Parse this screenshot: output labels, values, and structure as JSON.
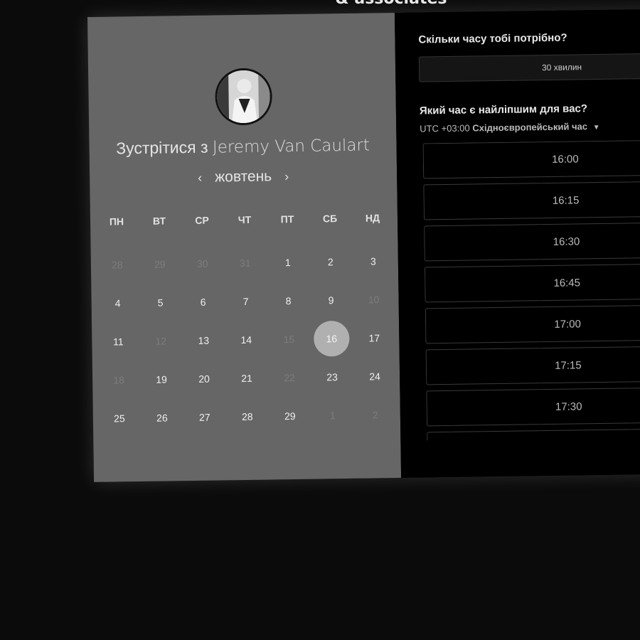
{
  "brand": "& associates",
  "host": {
    "title_prefix": "Зустрітися з",
    "name": "Jeremy Van Caulart"
  },
  "calendar": {
    "month": "жовтень",
    "prev_icon": "chevron-left-icon",
    "next_icon": "chevron-right-icon",
    "weekdays": [
      "ПН",
      "ВТ",
      "СР",
      "ЧТ",
      "ПТ",
      "СБ",
      "НД"
    ],
    "weeks": [
      [
        {
          "d": "28",
          "muted": true
        },
        {
          "d": "29",
          "muted": true
        },
        {
          "d": "30",
          "muted": true
        },
        {
          "d": "31",
          "muted": true
        },
        {
          "d": "1"
        },
        {
          "d": "2"
        },
        {
          "d": "3"
        }
      ],
      [
        {
          "d": "4"
        },
        {
          "d": "5"
        },
        {
          "d": "6"
        },
        {
          "d": "7"
        },
        {
          "d": "8"
        },
        {
          "d": "9"
        },
        {
          "d": "10",
          "muted": true
        }
      ],
      [
        {
          "d": "11"
        },
        {
          "d": "12",
          "muted": true
        },
        {
          "d": "13"
        },
        {
          "d": "14"
        },
        {
          "d": "15",
          "muted": true
        },
        {
          "d": "16",
          "selected": true
        },
        {
          "d": "17"
        }
      ],
      [
        {
          "d": "18",
          "muted": true
        },
        {
          "d": "19"
        },
        {
          "d": "20"
        },
        {
          "d": "21"
        },
        {
          "d": "22",
          "muted": true
        },
        {
          "d": "23"
        },
        {
          "d": "24"
        }
      ],
      [
        {
          "d": "25"
        },
        {
          "d": "26"
        },
        {
          "d": "27"
        },
        {
          "d": "28"
        },
        {
          "d": "29"
        },
        {
          "d": "1",
          "muted": true
        },
        {
          "d": "2",
          "muted": true
        }
      ]
    ]
  },
  "booking": {
    "duration_question": "Скільки часу тобі потрібно?",
    "duration_value": "30 хвилин",
    "time_question": "Який час є найліпшим для вас?",
    "timezone_offset": "UTC +03:00",
    "timezone_name": "Східноєвропейський час",
    "slots": [
      "16:00",
      "16:15",
      "16:30",
      "16:45",
      "17:00",
      "17:15",
      "17:30",
      ""
    ]
  }
}
